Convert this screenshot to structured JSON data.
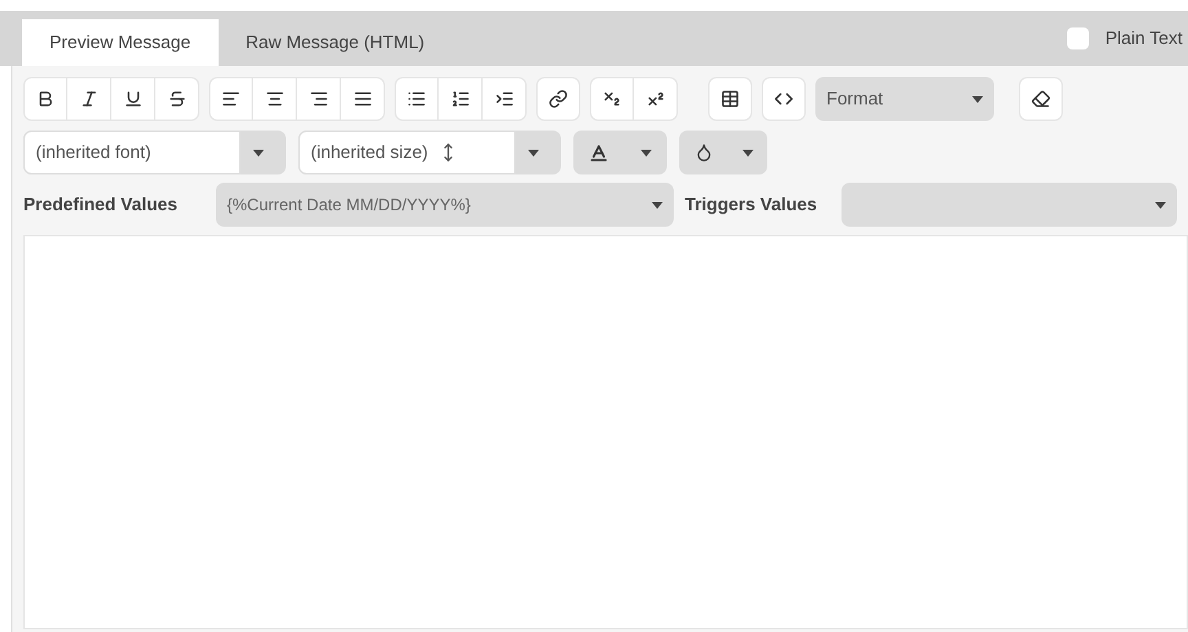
{
  "tabs": [
    {
      "label": "Preview Message",
      "selected": true
    },
    {
      "label": "Raw Message (HTML)",
      "selected": false
    }
  ],
  "plain_text": {
    "label": "Plain Text",
    "checked": false
  },
  "toolbar": {
    "format": "Format",
    "font": "(inherited font)",
    "size": "(inherited size)"
  },
  "predefined": {
    "label": "Predefined Values",
    "value": "{%Current Date MM/DD/YYYY%}"
  },
  "triggers": {
    "label": "Triggers Values"
  }
}
